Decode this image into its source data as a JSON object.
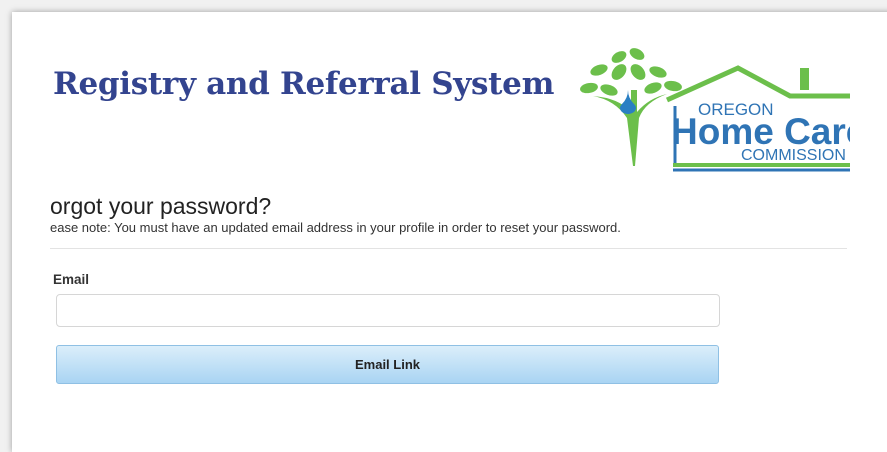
{
  "header": {
    "title": "Registry and Referral System"
  },
  "logo": {
    "line1": "OREGON",
    "line2": "Home Care",
    "line3": "COMMISSION",
    "colors": {
      "green": "#6cbf4b",
      "blue": "#2f74b5",
      "drop": "#2a7fc3"
    }
  },
  "form": {
    "heading": "orgot your password?",
    "note": "ease note: You must have an updated email address in your profile in order to reset your password.",
    "email_label": "Email",
    "email_value": "",
    "email_placeholder": "",
    "submit_label": "Email Link"
  }
}
